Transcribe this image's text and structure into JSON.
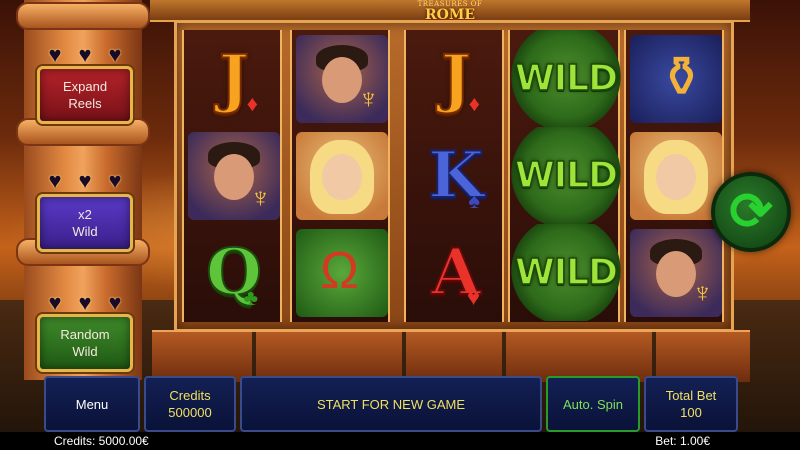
{
  "logo": {
    "line1": "TREASURES OF",
    "line2": "ROME"
  },
  "features": [
    {
      "label_line1": "Expand",
      "label_line2": "Reels",
      "color": "#b5222a"
    },
    {
      "label_line1": "x2",
      "label_line2": "Wild",
      "color": "#5a3ac8"
    },
    {
      "label_line1": "Random",
      "label_line2": "Wild",
      "color": "#3f8a2a"
    }
  ],
  "reels": [
    [
      "J",
      "bacchus-with-goblet",
      "Q"
    ],
    [
      "bacchus-with-goblet",
      "blonde-lady",
      "lyre"
    ],
    [
      "J",
      "K",
      "A"
    ],
    [
      "WILD",
      "WILD",
      "WILD"
    ],
    [
      "amphora",
      "blonde-lady",
      "bacchus-with-goblet"
    ]
  ],
  "symbols": {
    "J_suit": "♦",
    "K_suit": "♠",
    "Q_suit": "♣",
    "A_suit": "♥",
    "wild_label": "WILD"
  },
  "controls": {
    "menu_label": "Menu",
    "credits_label": "Credits",
    "credits_value": "500000",
    "message": "START FOR NEW GAME",
    "auto_spin_label": "Auto. Spin",
    "total_bet_label": "Total Bet",
    "total_bet_value": "100"
  },
  "status": {
    "credits_text": "Credits: 5000.00€",
    "bet_text": "Bet: 1.00€"
  },
  "spin_icon": "refresh-arrows-icon"
}
